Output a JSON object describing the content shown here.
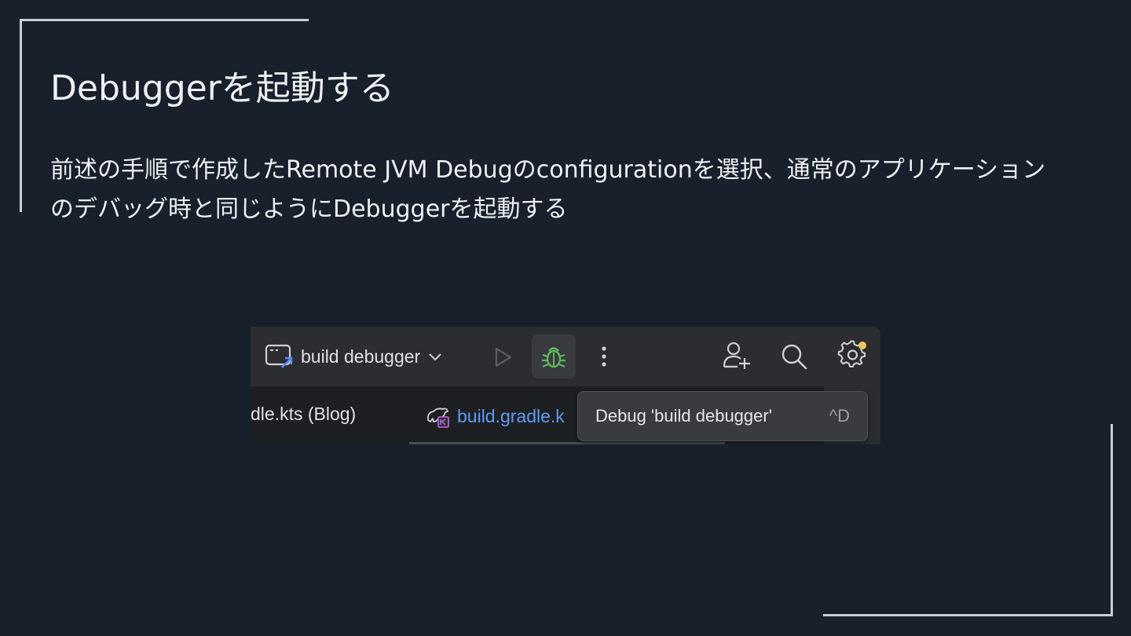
{
  "slide": {
    "title": "Debuggerを起動する",
    "body": "前述の手順で作成したRemote JVM Debugのconfigurationを選択、通常のアプリケーションのデバッグ時と同じようにDebuggerを起動する"
  },
  "ide": {
    "run_config": {
      "label": "build debugger",
      "icon": "run-configuration-icon"
    },
    "toolbar_icons": [
      "chevron-down-icon",
      "run-icon",
      "debug-icon",
      "more-vertical-icon",
      "add-user-icon",
      "search-icon",
      "settings-icon"
    ],
    "tabs": [
      {
        "label": "dle.kts (Blog)"
      },
      {
        "label": "build.gradle.k",
        "icon": "gradle-kotlin-icon",
        "active": true
      }
    ],
    "tooltip": {
      "text": "Debug 'build debugger'",
      "shortcut": "^D"
    },
    "colors": {
      "debug_green": "#5fb85a",
      "link_blue": "#5b9cf5",
      "notification_dot": "#f2c55c"
    }
  }
}
